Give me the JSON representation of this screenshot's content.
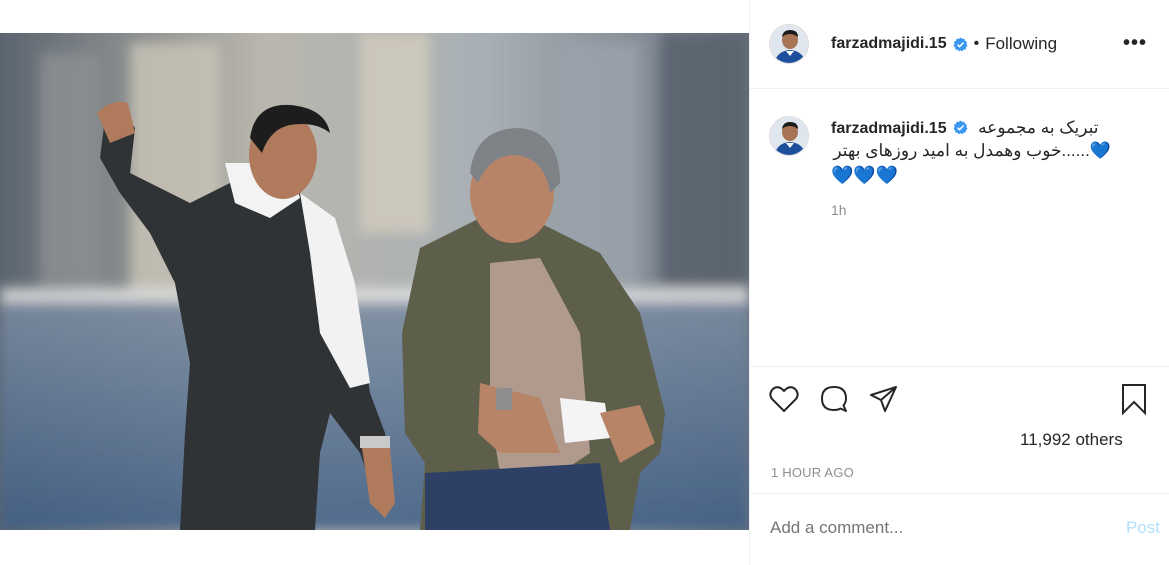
{
  "post": {
    "username": "farzadmajidi.15",
    "separator": "•",
    "follow_status": "Following",
    "more_label": "•••",
    "caption_username": "farzadmajidi.15",
    "caption_line1": "تبریک به مجموعه",
    "caption_line2": "......خوب وهمدل به امید روزهای بهتر",
    "caption_hearts_inline": "💙",
    "caption_hearts": "💙💙💙",
    "caption_time": "1h",
    "likes": "11,992 others",
    "timestamp": "1 HOUR AGO",
    "comment_placeholder": "Add a comment...",
    "post_label": "Post"
  },
  "icons": {
    "like": "heart-icon",
    "comment": "comment-icon",
    "share": "share-icon",
    "save": "bookmark-icon",
    "verified": "verified-badge-icon"
  },
  "colors": {
    "verified": "#3897f0",
    "heart_emoji": "#28b6e8",
    "post_button": "#b2dffc",
    "secondary_text": "#8e8e8e"
  }
}
